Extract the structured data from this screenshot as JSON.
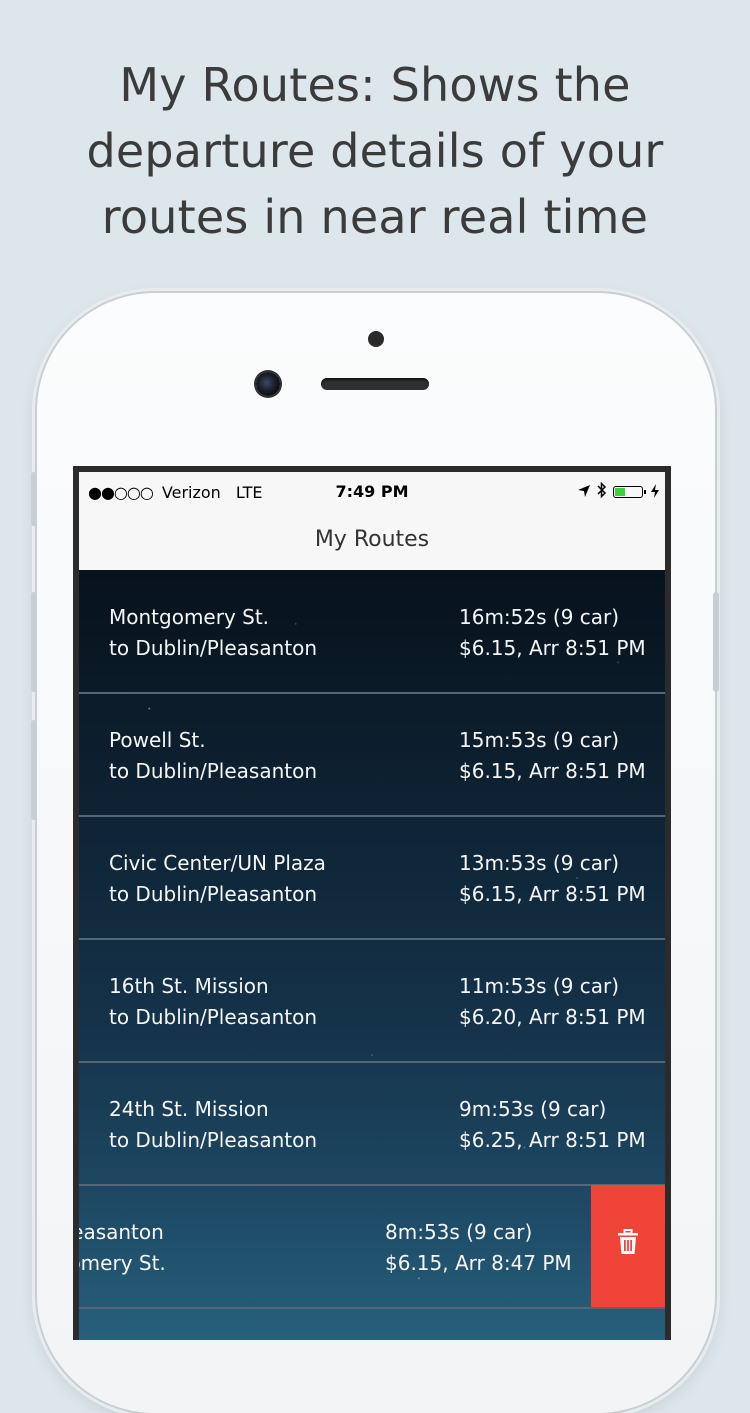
{
  "headline": {
    "line1": "My Routes: Shows the",
    "line2": "departure details of your",
    "line3": "routes in near real time"
  },
  "status_bar": {
    "signal": "●●○○○",
    "carrier": "Verizon",
    "network": "LTE",
    "time": "7:49 PM",
    "battery_level": 0.35
  },
  "nav": {
    "title": "My Routes"
  },
  "routes": [
    {
      "line1": "Montgomery St.",
      "line2": "to Dublin/Pleasanton",
      "eta": "16m:52s (9 car)",
      "fare": "$6.15, Arr 8:51 PM"
    },
    {
      "line1": "Powell St.",
      "line2": "to Dublin/Pleasanton",
      "eta": "15m:53s (9 car)",
      "fare": "$6.15, Arr 8:51 PM"
    },
    {
      "line1": "Civic Center/UN Plaza",
      "line2": "to Dublin/Pleasanton",
      "eta": "13m:53s (9 car)",
      "fare": "$6.15, Arr 8:51 PM"
    },
    {
      "line1": "16th St. Mission",
      "line2": "to Dublin/Pleasanton",
      "eta": "11m:53s (9 car)",
      "fare": "$6.20, Arr 8:51 PM"
    },
    {
      "line1": "24th St. Mission",
      "line2": "to Dublin/Pleasanton",
      "eta": "9m:53s (9 car)",
      "fare": "$6.25, Arr 8:51 PM"
    },
    {
      "line1": "lin/Pleasanton",
      "line2": "ontgomery St.",
      "eta": "8m:53s (9 car)",
      "fare": "$6.15, Arr 8:47 PM"
    }
  ],
  "colors": {
    "delete": "#f04438",
    "battery": "#3fcf3a"
  },
  "icons": {
    "delete": "trash-icon",
    "location": "location-arrow-icon",
    "bluetooth": "bluetooth-icon",
    "charging": "charging-bolt-icon"
  }
}
